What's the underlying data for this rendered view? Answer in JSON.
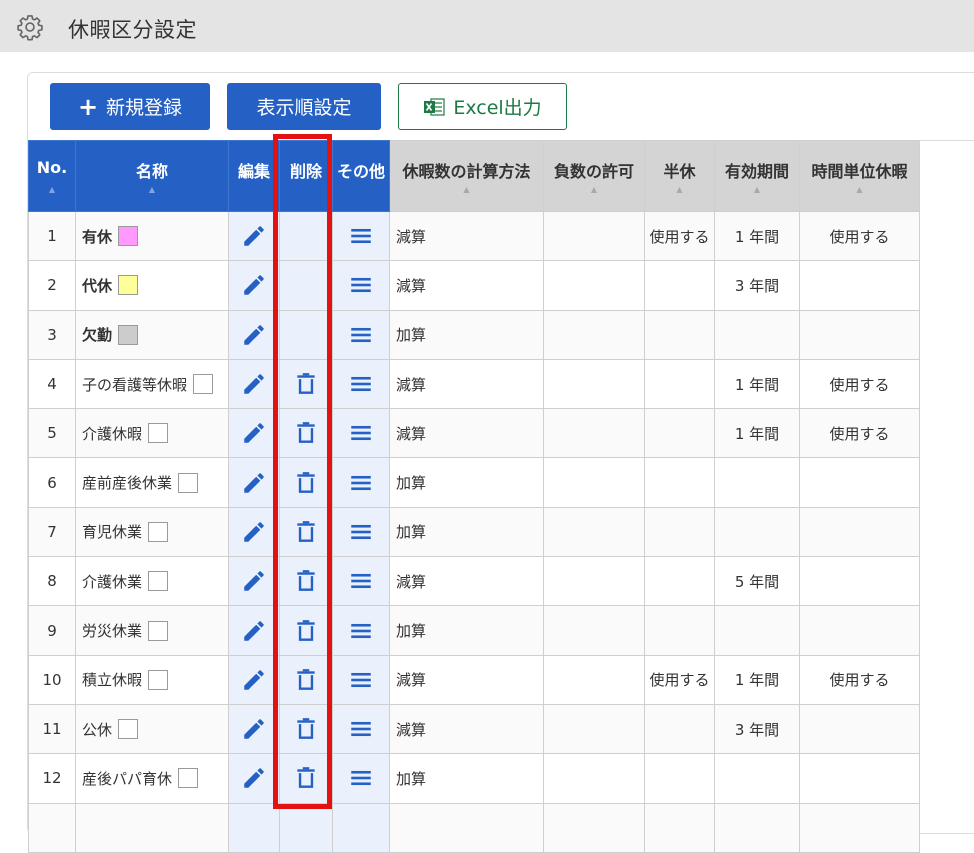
{
  "header": {
    "title": "休暇区分設定",
    "icon": "gear-icon"
  },
  "toolbar": {
    "new_plus": "+",
    "new_label": "新規登録",
    "order_label": "表示順設定",
    "excel_label": "Excel出力"
  },
  "colors": {
    "primary": "#2560c5",
    "excel": "#1d7a45",
    "highlight": "#e41111",
    "action_bg": "#eaf1fc"
  },
  "table": {
    "headers": {
      "no": "No.",
      "name": "名称",
      "edit": "編集",
      "delete": "削除",
      "other": "その他",
      "calc": "休暇数の計算方法",
      "negative": "負数の許可",
      "half": "半休",
      "validity": "有効期間",
      "hourly": "時間単位休暇"
    },
    "sort_mark": "▲",
    "rows": [
      {
        "no": "1",
        "name": "有休",
        "bold": true,
        "color": "#ff99ff",
        "deletable": false,
        "calc": "減算",
        "negative": "",
        "half": "使用する",
        "validity": "1 年間",
        "hourly": "使用する"
      },
      {
        "no": "2",
        "name": "代休",
        "bold": true,
        "color": "#ffff99",
        "deletable": false,
        "calc": "減算",
        "negative": "",
        "half": "",
        "validity": "3 年間",
        "hourly": ""
      },
      {
        "no": "3",
        "name": "欠勤",
        "bold": true,
        "color": "#cccccc",
        "deletable": false,
        "calc": "加算",
        "negative": "",
        "half": "",
        "validity": "",
        "hourly": ""
      },
      {
        "no": "4",
        "name": "子の看護等休暇",
        "bold": false,
        "color": "#ffffff",
        "deletable": true,
        "calc": "減算",
        "negative": "",
        "half": "",
        "validity": "1 年間",
        "hourly": "使用する"
      },
      {
        "no": "5",
        "name": "介護休暇",
        "bold": false,
        "color": "#ffffff",
        "deletable": true,
        "calc": "減算",
        "negative": "",
        "half": "",
        "validity": "1 年間",
        "hourly": "使用する"
      },
      {
        "no": "6",
        "name": "産前産後休業",
        "bold": false,
        "color": "#ffffff",
        "deletable": true,
        "calc": "加算",
        "negative": "",
        "half": "",
        "validity": "",
        "hourly": ""
      },
      {
        "no": "7",
        "name": "育児休業",
        "bold": false,
        "color": "#ffffff",
        "deletable": true,
        "calc": "加算",
        "negative": "",
        "half": "",
        "validity": "",
        "hourly": ""
      },
      {
        "no": "8",
        "name": "介護休業",
        "bold": false,
        "color": "#ffffff",
        "deletable": true,
        "calc": "減算",
        "negative": "",
        "half": "",
        "validity": "5 年間",
        "hourly": ""
      },
      {
        "no": "9",
        "name": "労災休業",
        "bold": false,
        "color": "#ffffff",
        "deletable": true,
        "calc": "加算",
        "negative": "",
        "half": "",
        "validity": "",
        "hourly": ""
      },
      {
        "no": "10",
        "name": "積立休暇",
        "bold": false,
        "color": "#ffffff",
        "deletable": true,
        "calc": "減算",
        "negative": "",
        "half": "使用する",
        "validity": "1 年間",
        "hourly": "使用する"
      },
      {
        "no": "11",
        "name": "公休",
        "bold": false,
        "color": "#ffffff",
        "deletable": true,
        "calc": "減算",
        "negative": "",
        "half": "",
        "validity": "3 年間",
        "hourly": ""
      },
      {
        "no": "12",
        "name": "産後パパ育休",
        "bold": false,
        "color": "#ffffff",
        "deletable": true,
        "calc": "加算",
        "negative": "",
        "half": "",
        "validity": "",
        "hourly": ""
      },
      {
        "no": "",
        "name": "",
        "bold": false,
        "color": "",
        "deletable": false,
        "calc": "",
        "negative": "",
        "half": "",
        "validity": "",
        "hourly": ""
      }
    ]
  }
}
